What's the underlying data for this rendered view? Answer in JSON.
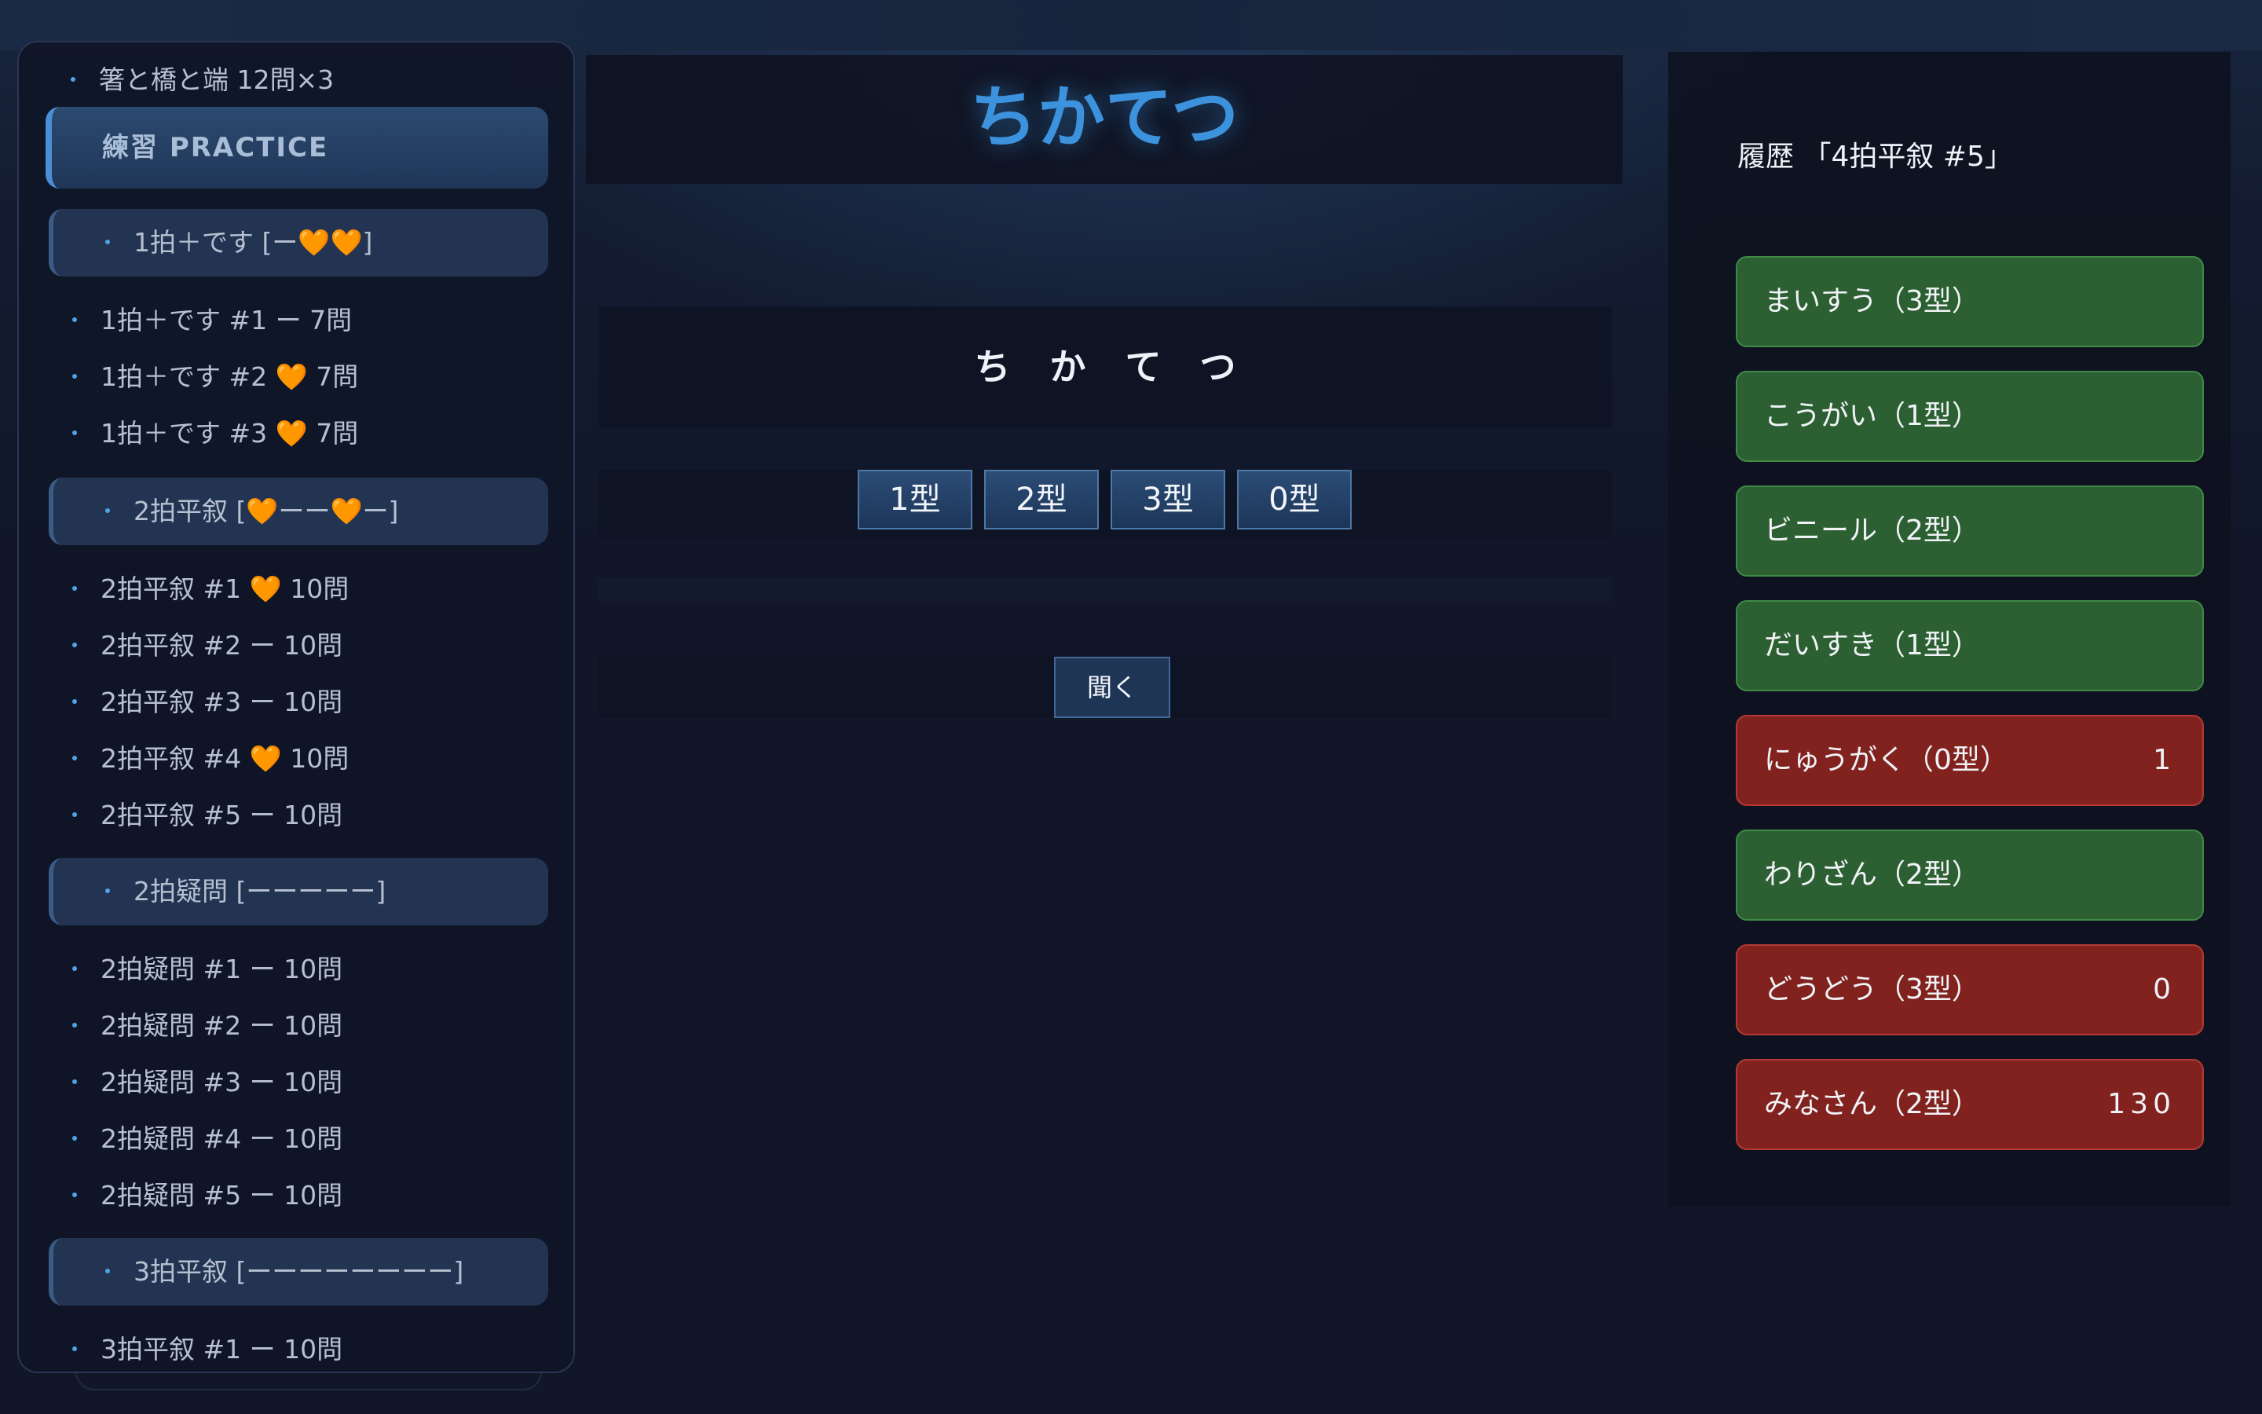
{
  "header": {
    "title": "ちかてつ"
  },
  "sidebar": {
    "top_item": "箸と橋と端 12問×3",
    "section_label": "練習 PRACTICE",
    "groups": [
      {
        "label": "1拍＋です [ー🧡🧡]",
        "items": [
          "1拍＋です #1 ー 7問",
          "1拍＋です #2 🧡 7問",
          "1拍＋です #3 🧡 7問"
        ]
      },
      {
        "label": "2拍平叙 [🧡ーー🧡ー]",
        "items": [
          "2拍平叙 #1 🧡 10問",
          "2拍平叙 #2 ー 10問",
          "2拍平叙 #3 ー 10問",
          "2拍平叙 #4 🧡 10問",
          "2拍平叙 #5 ー 10問"
        ]
      },
      {
        "label": "2拍疑問 [ーーーーー]",
        "items": [
          "2拍疑問 #1 ー 10問",
          "2拍疑問 #2 ー 10問",
          "2拍疑問 #3 ー 10問",
          "2拍疑問 #4 ー 10問",
          "2拍疑問 #5 ー 10問"
        ]
      },
      {
        "label": "3拍平叙 [ーーーーーーーー]",
        "items": [
          "3拍平叙 #1 ー 10問"
        ]
      }
    ]
  },
  "quiz": {
    "word_chars": "ちかてつ",
    "answers": [
      "1型",
      "2型",
      "3型",
      "0型"
    ],
    "listen_label": "聞く"
  },
  "history": {
    "title": "履歴 「4拍平叙 #5」",
    "items": [
      {
        "word": "まいすう（3型）",
        "status": "correct",
        "score": ""
      },
      {
        "word": "こうがい（1型）",
        "status": "correct",
        "score": ""
      },
      {
        "word": "ビニール（2型）",
        "status": "correct",
        "score": ""
      },
      {
        "word": "だいすき（1型）",
        "status": "correct",
        "score": ""
      },
      {
        "word": "にゅうがく（0型）",
        "status": "wrong",
        "score": "1"
      },
      {
        "word": "わりざん（2型）",
        "status": "correct",
        "score": ""
      },
      {
        "word": "どうどう（3型）",
        "status": "wrong",
        "score": "0"
      },
      {
        "word": "みなさん（2型）",
        "status": "wrong",
        "score": "130"
      }
    ]
  },
  "colors": {
    "title_blue": "#3c92dc",
    "correct_green": "#2c5f32",
    "wrong_red": "#82221f",
    "background": "#111729"
  }
}
